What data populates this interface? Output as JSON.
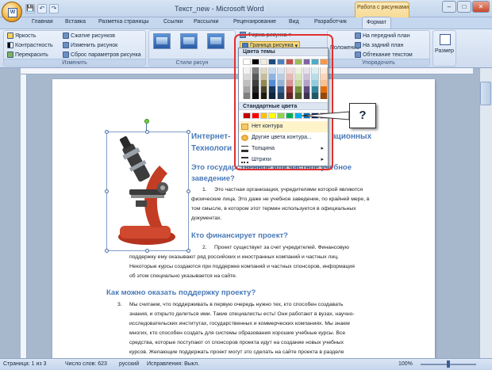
{
  "window": {
    "title": "Текст_new - Microsoft Word",
    "context_group": "Работа с рисунками"
  },
  "qat": {
    "save": "💾",
    "undo": "↶",
    "redo": "↷"
  },
  "window_buttons": {
    "minimize": "–",
    "maximize": "□",
    "close": "✕"
  },
  "tabs": [
    "Главная",
    "Вставка",
    "Разметка страницы",
    "Ссылки",
    "Рассылки",
    "Рецензирование",
    "Вид",
    "Разработчик"
  ],
  "active_tab": "Формат",
  "ribbon": {
    "adjust": {
      "label": "Изменить",
      "items": [
        "Яркость",
        "Контрастность",
        "Перекрасить",
        "Сжатие рисунков",
        "Изменить рисунок",
        "Сброс параметров рисунка"
      ]
    },
    "styles": {
      "label": "Стили рисун",
      "shape": "Форма рисунка",
      "border": "Граница рисунка"
    },
    "arrange": {
      "label": "Упорядочить",
      "position": "Положение",
      "items": [
        "На передний план",
        "На задний план",
        "Обтекание текстом"
      ]
    },
    "size": {
      "label": "Размер"
    }
  },
  "dropdown": {
    "theme_header": "Цвета темы",
    "standard_header": "Стандартные цвета",
    "no_outline": "Нет контура",
    "more_colors": "Другие цвета контура...",
    "weight": "Толщина",
    "dashes": "Штрихи",
    "theme_top": [
      "#ffffff",
      "#000000",
      "#eeece1",
      "#1f497d",
      "#4f81bd",
      "#c0504d",
      "#9bbb59",
      "#8064a2",
      "#4bacc6",
      "#f79646"
    ],
    "theme_rows": [
      [
        "#f2f2f2",
        "#7f7f7f",
        "#ddd9c3",
        "#c6d9f0",
        "#dbe5f1",
        "#f2dcdb",
        "#ebf1dd",
        "#e5e0ec",
        "#dbeef3",
        "#fdeada"
      ],
      [
        "#d8d8d8",
        "#595959",
        "#c4bd97",
        "#8db3e2",
        "#b8cce4",
        "#e5b9b7",
        "#d7e3bc",
        "#ccc1d9",
        "#b7dde8",
        "#fbd5b5"
      ],
      [
        "#bfbfbf",
        "#3f3f3f",
        "#938953",
        "#548dd4",
        "#95b3d7",
        "#d99694",
        "#c3d69b",
        "#b2a2c7",
        "#92cddc",
        "#fac08f"
      ],
      [
        "#a5a5a5",
        "#262626",
        "#494429",
        "#17365d",
        "#366092",
        "#953734",
        "#76923c",
        "#5f497a",
        "#31859b",
        "#e36c09"
      ],
      [
        "#7f7f7f",
        "#0c0c0c",
        "#1d1b10",
        "#0f243e",
        "#244061",
        "#632423",
        "#4f6128",
        "#3f3151",
        "#205867",
        "#974806"
      ]
    ],
    "standard": [
      "#c00000",
      "#ff0000",
      "#ffc000",
      "#ffff00",
      "#92d050",
      "#00b050",
      "#00b0f0",
      "#0070c0",
      "#002060",
      "#7030a0"
    ]
  },
  "callout": "?",
  "document": {
    "title_line1": "Интернет-",
    "title_line1_end": "ационных",
    "title_line2": "Технологи",
    "h_state": "Это государственное или частное учебное",
    "h_state2": "заведение?",
    "p1_num": "1.",
    "p1": [
      "Это частная организация, учредителями которой являются",
      "физические лица. Это даже не учебное заведение, по крайней мере, в",
      "том смысле, в котором этот термин используется в официальных",
      "документах."
    ],
    "h_fund": "Кто финансирует проект?",
    "p2_num": "2.",
    "p2": [
      "Проект существует за счет учредителей. Финансовую",
      "поддержку ему оказывают ряд российских и иностранных компаний и частных лиц.",
      "Некоторые курсы создаются при поддержке компаний и частных спонсоров, информация",
      "об этом специально указывается на сайте."
    ],
    "h_support": "Как можно оказать поддержку  проекту?",
    "p3_num": "3.",
    "p3": [
      "Мы считаем, что поддерживать в первую очередь нужно тех, кто способен создавать",
      "знания, и открыто делиться ими. Такие специалисты есть! Они работают в вузах, научно-",
      "исследовательских институтах, государственных и коммерческих компаниях. Мы знаем",
      "многих, кто способен создать для системы образования хорошие учебные курсы. Все",
      "средства, которые поступают от спонсоров проекта идут на создание новых учебных",
      "курсов. Желающие поддержать проект могут это сделать на сайте проекта в разделе"
    ]
  },
  "status": {
    "page": "Страница: 1 из 3",
    "words": "Число слов: 623",
    "lang": "русский",
    "track": "Исправления: Выкл.",
    "zoom": "100%"
  }
}
